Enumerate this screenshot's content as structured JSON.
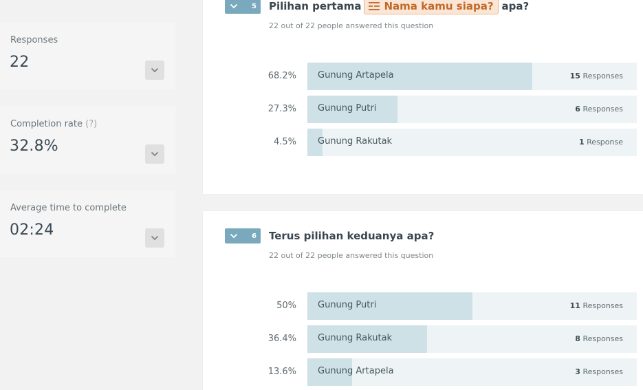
{
  "stats": [
    {
      "label": "Responses",
      "hint": "",
      "value": "22"
    },
    {
      "label": "Completion rate",
      "hint": "(?)",
      "value": "32.8%"
    },
    {
      "label": "Average time to complete",
      "hint": "",
      "value": "02:24"
    }
  ],
  "questions": [
    {
      "number": "5",
      "title_before": "Pilihan pertama",
      "recall_chip": "Nama kamu siapa?",
      "title_after": "apa?",
      "answered": "22 out of 22 people answered this question",
      "options": [
        {
          "pct": "68.2%",
          "fraction": 0.682,
          "label": "Gunung Artapela",
          "count": "15",
          "unit": "Responses"
        },
        {
          "pct": "27.3%",
          "fraction": 0.273,
          "label": "Gunung Putri",
          "count": "6",
          "unit": "Responses"
        },
        {
          "pct": "4.5%",
          "fraction": 0.045,
          "label": "Gunung Rakutak",
          "count": "1",
          "unit": "Response"
        }
      ]
    },
    {
      "number": "6",
      "title": "Terus pilihan keduanya apa?",
      "answered": "22 out of 22 people answered this question",
      "options": [
        {
          "pct": "50%",
          "fraction": 0.5,
          "label": "Gunung Putri",
          "count": "11",
          "unit": "Responses"
        },
        {
          "pct": "36.4%",
          "fraction": 0.364,
          "label": "Gunung Rakutak",
          "count": "8",
          "unit": "Responses"
        },
        {
          "pct": "13.6%",
          "fraction": 0.136,
          "label": "Gunung Artapela",
          "count": "3",
          "unit": "Responses"
        }
      ]
    }
  ],
  "colors": {
    "badge": "#7aa9bd",
    "bar_fill": "#cde1e6",
    "bar_track": "#eef4f6",
    "recall_chip_bg": "#fbe6d6",
    "recall_chip_text": "#c06a2a"
  }
}
